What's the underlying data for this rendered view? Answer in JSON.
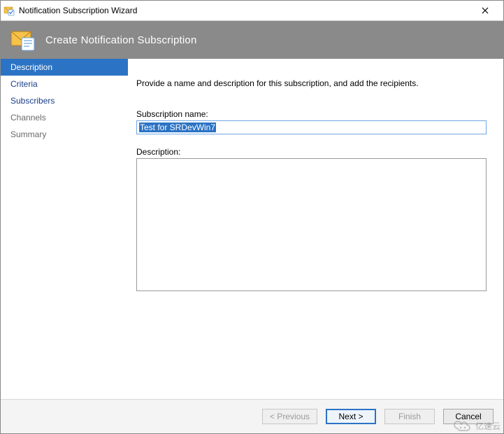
{
  "window": {
    "title": "Notification Subscription Wizard"
  },
  "banner": {
    "title": "Create Notification Subscription"
  },
  "sidebar": {
    "steps": [
      {
        "label": "Description",
        "active": true,
        "dim": false
      },
      {
        "label": "Criteria",
        "active": false,
        "dim": false
      },
      {
        "label": "Subscribers",
        "active": false,
        "dim": false
      },
      {
        "label": "Channels",
        "active": false,
        "dim": true
      },
      {
        "label": "Summary",
        "active": false,
        "dim": true
      }
    ]
  },
  "content": {
    "instruction": "Provide a name and description for this subscription, and add the recipients.",
    "sub_name_label": "Subscription name:",
    "sub_name_value": "Test for SRDevWin7",
    "desc_label": "Description:",
    "desc_value": ""
  },
  "footer": {
    "previous": "< Previous",
    "next": "Next >",
    "finish": "Finish",
    "cancel": "Cancel"
  },
  "watermark": {
    "text": "亿速云"
  }
}
